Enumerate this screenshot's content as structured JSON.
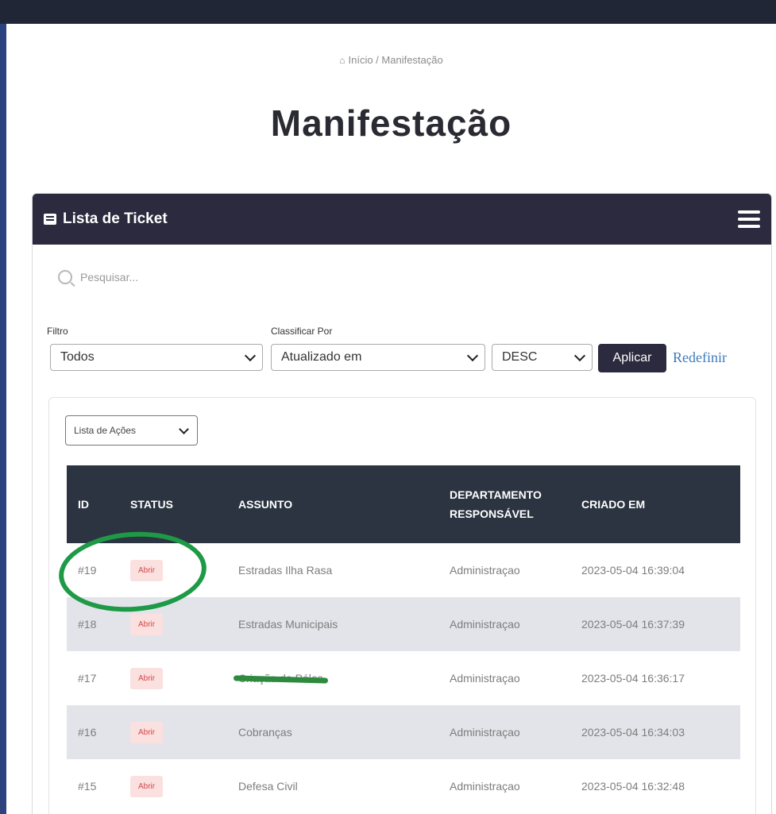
{
  "breadcrumb": {
    "text": "Início / Manifestação"
  },
  "page_title": "Manifestação",
  "card": {
    "title": "Lista de Ticket"
  },
  "search": {
    "placeholder": "Pesquisar..."
  },
  "filters": {
    "filter_label": "Filtro",
    "filter_value": "Todos",
    "sort_label": "Classificar Por",
    "sort_value": "Atualizado em",
    "order_value": "DESC",
    "apply_label": "Aplicar",
    "reset_label": "Redefinir"
  },
  "actions": {
    "label": "Lista de Ações"
  },
  "table": {
    "headers": {
      "id": "ID",
      "status": "STATUS",
      "subject": "ASSUNTO",
      "department_line1": "DEPARTAMENTO",
      "department_line2": "RESPONSÁVEL",
      "created": "CRIADO EM"
    },
    "rows": [
      {
        "id": "#19",
        "status": "Abrir",
        "subject": "Estradas Ilha Rasa",
        "department": "Administraçao",
        "created": "2023-05-04 16:39:04"
      },
      {
        "id": "#18",
        "status": "Abrir",
        "subject": "Estradas Municipais",
        "department": "Administraçao",
        "created": "2023-05-04 16:37:39"
      },
      {
        "id": "#17",
        "status": "Abrir",
        "subject": "Criação de Pólos",
        "department": "Administraçao",
        "created": "2023-05-04 16:36:17"
      },
      {
        "id": "#16",
        "status": "Abrir",
        "subject": "Cobranças",
        "department": "Administraçao",
        "created": "2023-05-04 16:34:03"
      },
      {
        "id": "#15",
        "status": "Abrir",
        "subject": "Defesa Civil",
        "department": "Administraçao",
        "created": "2023-05-04 16:32:48"
      }
    ]
  },
  "colors": {
    "header_dark": "#2b2a3e",
    "table_head": "#2b3440",
    "accent_link": "#3c7bbf",
    "annotation_green": "#1e9a46"
  },
  "icons": [
    "home-icon",
    "list-icon",
    "hamburger-icon",
    "search-icon",
    "chevron-down-icon"
  ]
}
